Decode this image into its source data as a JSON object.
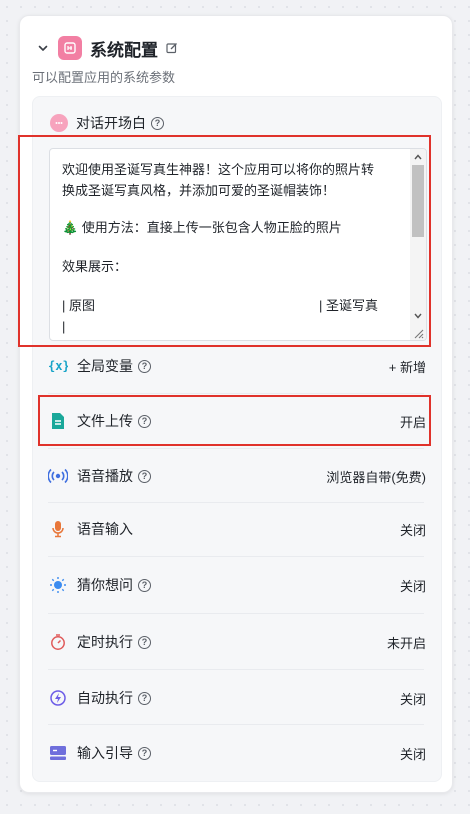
{
  "panel": {
    "title": "系统配置",
    "subtitle": "可以配置应用的系统参数"
  },
  "opening": {
    "label": "对话开场白",
    "help": "?",
    "lines": [
      "欢迎使用圣诞写真生神器！这个应用可以将你的照片转",
      "换成圣诞写真风格，并添加可爱的圣诞帽装饰！",
      "",
      "🎄 使用方法：直接上传一张包含人物正脸的照片",
      "",
      "效果展示："
    ],
    "table_header": [
      "| 原图",
      "| 圣诞写真"
    ],
    "table_rows": [
      "|",
      "|"
    ]
  },
  "rows": [
    {
      "label": "全局变量",
      "value": "+ 新增",
      "icon": "variable-icon"
    },
    {
      "label": "文件上传",
      "value": "开启",
      "icon": "file-icon"
    },
    {
      "label": "语音播放",
      "value": "浏览器自带(免费)",
      "icon": "speaker-icon"
    },
    {
      "label": "语音输入",
      "value": "关闭",
      "icon": "microphone-icon"
    },
    {
      "label": "猜你想问",
      "value": "关闭",
      "icon": "lightbulb-icon"
    },
    {
      "label": "定时执行",
      "value": "未开启",
      "icon": "timer-icon"
    },
    {
      "label": "自动执行",
      "value": "关闭",
      "icon": "lightning-icon"
    },
    {
      "label": "输入引导",
      "value": "关闭",
      "icon": "keyboard-icon"
    }
  ],
  "colors": {
    "highlight": "#e0322b",
    "app_icon": "#f27fa3",
    "variable": "#19a4c8",
    "file": "#1aa89a",
    "speaker": "#3f6fe0",
    "microphone": "#e8773a",
    "lightbulb": "#3c8cf0",
    "timer": "#e05a5a",
    "lightning": "#6c5ce7",
    "keyboard": "#6f6fdc"
  }
}
